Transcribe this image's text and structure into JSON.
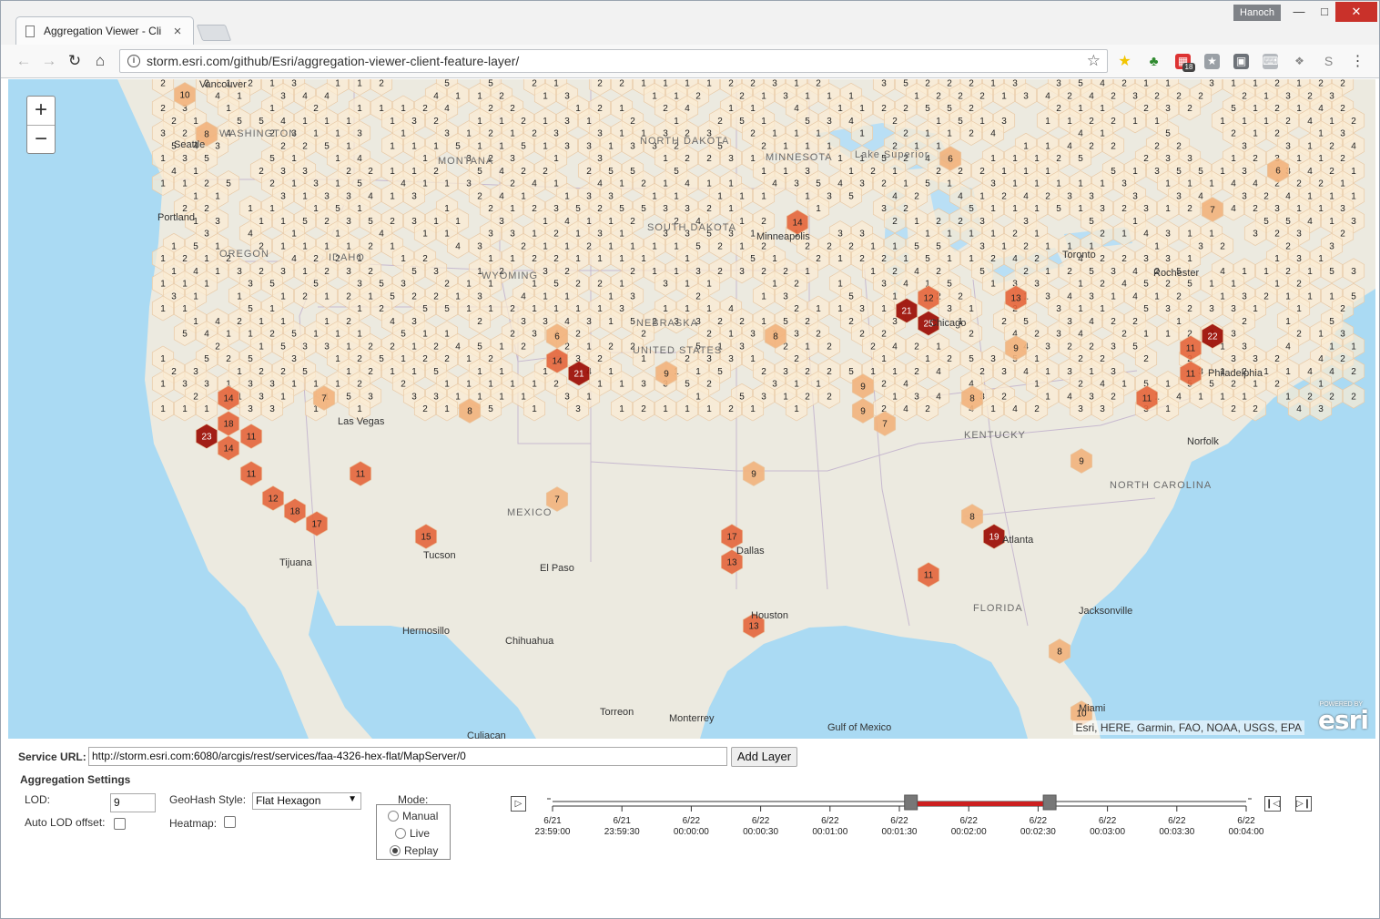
{
  "browser": {
    "tab_title": "Aggregation Viewer - Cli",
    "tab_close": "×",
    "user": "Hanoch",
    "url": "storm.esri.com/github/Esri/aggregation-viewer-client-feature-layer/",
    "ext_badge": "18"
  },
  "map": {
    "zoom_in": "+",
    "zoom_out": "−",
    "attribution": "Esri, HERE, Garmin, FAO, NOAA, USGS, EPA",
    "logo": "esri",
    "logo_powered": "POWERED BY",
    "cities": [
      {
        "name": "Vancouver"
      },
      {
        "name": "Seattle"
      },
      {
        "name": "Portland"
      },
      {
        "name": "Las Vegas"
      },
      {
        "name": "Tijuana"
      },
      {
        "name": "Hermosillo"
      },
      {
        "name": "Chihuahua"
      },
      {
        "name": "Torreon"
      },
      {
        "name": "Monterrey"
      },
      {
        "name": "Culiacan"
      },
      {
        "name": "Toronto"
      },
      {
        "name": "Rochester"
      },
      {
        "name": "Philadelphia"
      },
      {
        "name": "Norfolk"
      },
      {
        "name": "Tucson"
      },
      {
        "name": "El Paso"
      },
      {
        "name": "Dallas"
      },
      {
        "name": "Houston"
      },
      {
        "name": "Atlanta"
      },
      {
        "name": "Chicago"
      },
      {
        "name": "Jacksonville"
      },
      {
        "name": "Miami"
      },
      {
        "name": "Minneapolis"
      },
      {
        "name": "Gulf of Mexico"
      }
    ],
    "states": [
      {
        "name": "MONTANA"
      },
      {
        "name": "WASHINGTON"
      },
      {
        "name": "OREGON"
      },
      {
        "name": "IDAHO"
      },
      {
        "name": "WYOMING"
      },
      {
        "name": "NEBRASKA"
      },
      {
        "name": "NORTH DAKOTA"
      },
      {
        "name": "SOUTH DAKOTA"
      },
      {
        "name": "MINNESOTA"
      },
      {
        "name": "UNITED STATES"
      },
      {
        "name": "MEXICO"
      },
      {
        "name": "NORTH CAROLINA"
      },
      {
        "name": "KENTUCKY"
      },
      {
        "name": "FLORIDA"
      },
      {
        "name": "Lake Superior"
      }
    ],
    "hexes": [
      {
        "v": 10
      },
      {
        "v": 8
      },
      {
        "v": 14
      },
      {
        "v": 18
      },
      {
        "v": 23
      },
      {
        "v": 14
      },
      {
        "v": 11
      },
      {
        "v": 11
      },
      {
        "v": 12
      },
      {
        "v": 18
      },
      {
        "v": 17
      },
      {
        "v": 15
      },
      {
        "v": 11
      },
      {
        "v": 21
      },
      {
        "v": 14
      },
      {
        "v": 8
      },
      {
        "v": 17
      },
      {
        "v": 13
      },
      {
        "v": 13
      },
      {
        "v": 9
      },
      {
        "v": 8
      },
      {
        "v": 14
      },
      {
        "v": 21
      },
      {
        "v": 25
      },
      {
        "v": 12
      },
      {
        "v": 13
      },
      {
        "v": 9
      },
      {
        "v": 11
      },
      {
        "v": 19
      },
      {
        "v": 11
      },
      {
        "v": 22
      },
      {
        "v": 11
      },
      {
        "v": 11
      },
      {
        "v": 9
      },
      {
        "v": 9
      },
      {
        "v": 8
      },
      {
        "v": 10
      },
      {
        "v": 8
      },
      {
        "v": 9
      },
      {
        "v": 9
      },
      {
        "v": 7
      },
      {
        "v": 7
      },
      {
        "v": 6
      },
      {
        "v": 6
      },
      {
        "v": 7
      },
      {
        "v": 6
      },
      {
        "v": 8
      },
      {
        "v": 7
      }
    ]
  },
  "controls": {
    "service_url_label": "Service URL:",
    "service_url_value": "http://storm.esri.com:6080/arcgis/rest/services/faa-4326-hex-flat/MapServer/0",
    "add_layer": "Add Layer",
    "settings_title": "Aggregation Settings",
    "lod_label": "LOD:",
    "lod_value": "9",
    "auto_lod_label": "Auto LOD offset:",
    "geohash_label": "GeoHash Style:",
    "geohash_value": "Flat Hexagon",
    "heatmap_label": "Heatmap:",
    "mode_title": "Mode:",
    "modes": [
      "Manual",
      "Live",
      "Replay"
    ],
    "selected_mode": "Replay"
  },
  "timeline": {
    "ticks": [
      {
        "date": "6/21",
        "time": "23:59:00"
      },
      {
        "date": "6/21",
        "time": "23:59:30"
      },
      {
        "date": "6/22",
        "time": "00:00:00"
      },
      {
        "date": "6/22",
        "time": "00:00:30"
      },
      {
        "date": "6/22",
        "time": "00:01:00"
      },
      {
        "date": "6/22",
        "time": "00:01:30"
      },
      {
        "date": "6/22",
        "time": "00:02:00"
      },
      {
        "date": "6/22",
        "time": "00:02:30"
      },
      {
        "date": "6/22",
        "time": "00:03:00"
      },
      {
        "date": "6/22",
        "time": "00:03:30"
      },
      {
        "date": "6/22",
        "time": "00:04:00"
      }
    ],
    "range_start": "00:01:35",
    "range_end": "00:02:35",
    "range_color": "#cc1f1f"
  },
  "colors": {
    "hex_low": "#fbecd2",
    "hex_mid": "#f2b27c",
    "hex_high": "#e4653b",
    "hex_max": "#9a0800"
  }
}
